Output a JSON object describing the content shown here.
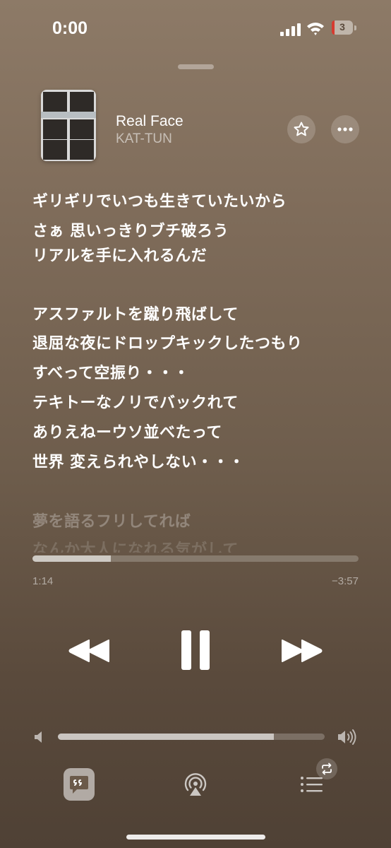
{
  "status_bar": {
    "time": "0:00",
    "battery_level": "3",
    "battery_low_color": "#d63b30",
    "icons": [
      "cellular-signal-icon",
      "wifi-icon",
      "battery-icon"
    ]
  },
  "now_playing": {
    "title": "Real Face",
    "artist": "KAT-TUN",
    "album_art_label": "KAT-TUN",
    "actions": [
      "star-icon",
      "more-icon"
    ]
  },
  "lyrics": {
    "lines": [
      "ギリギリでいつも生きていたいから",
      "さぁ 思いっきりブチ破ろう",
      "リアルを手に入れるんだ",
      "",
      "アスファルトを蹴り飛ばして",
      "退屈な夜にドロップキックしたつもり",
      "すべって空振り・・・",
      "テキトーなノリでバックれて",
      "ありえねーウソ並べたって",
      "世界 変えられやしない・・・",
      "",
      "夢を語るフリしてれば",
      "なんか大人になれる気がして"
    ]
  },
  "playback": {
    "elapsed": "1:14",
    "remaining": "−3:57",
    "progress_fraction": 0.24,
    "volume_fraction": 0.81
  },
  "controls": {
    "icons": [
      "rewind-icon",
      "pause-icon",
      "fast-forward-icon"
    ]
  },
  "bottom_bar": {
    "icons": [
      "lyrics-icon",
      "airplay-icon",
      "queue-icon",
      "repeat-icon"
    ]
  },
  "colors": {
    "background_top": "#8d7a67",
    "background_bottom": "#4f4135"
  }
}
